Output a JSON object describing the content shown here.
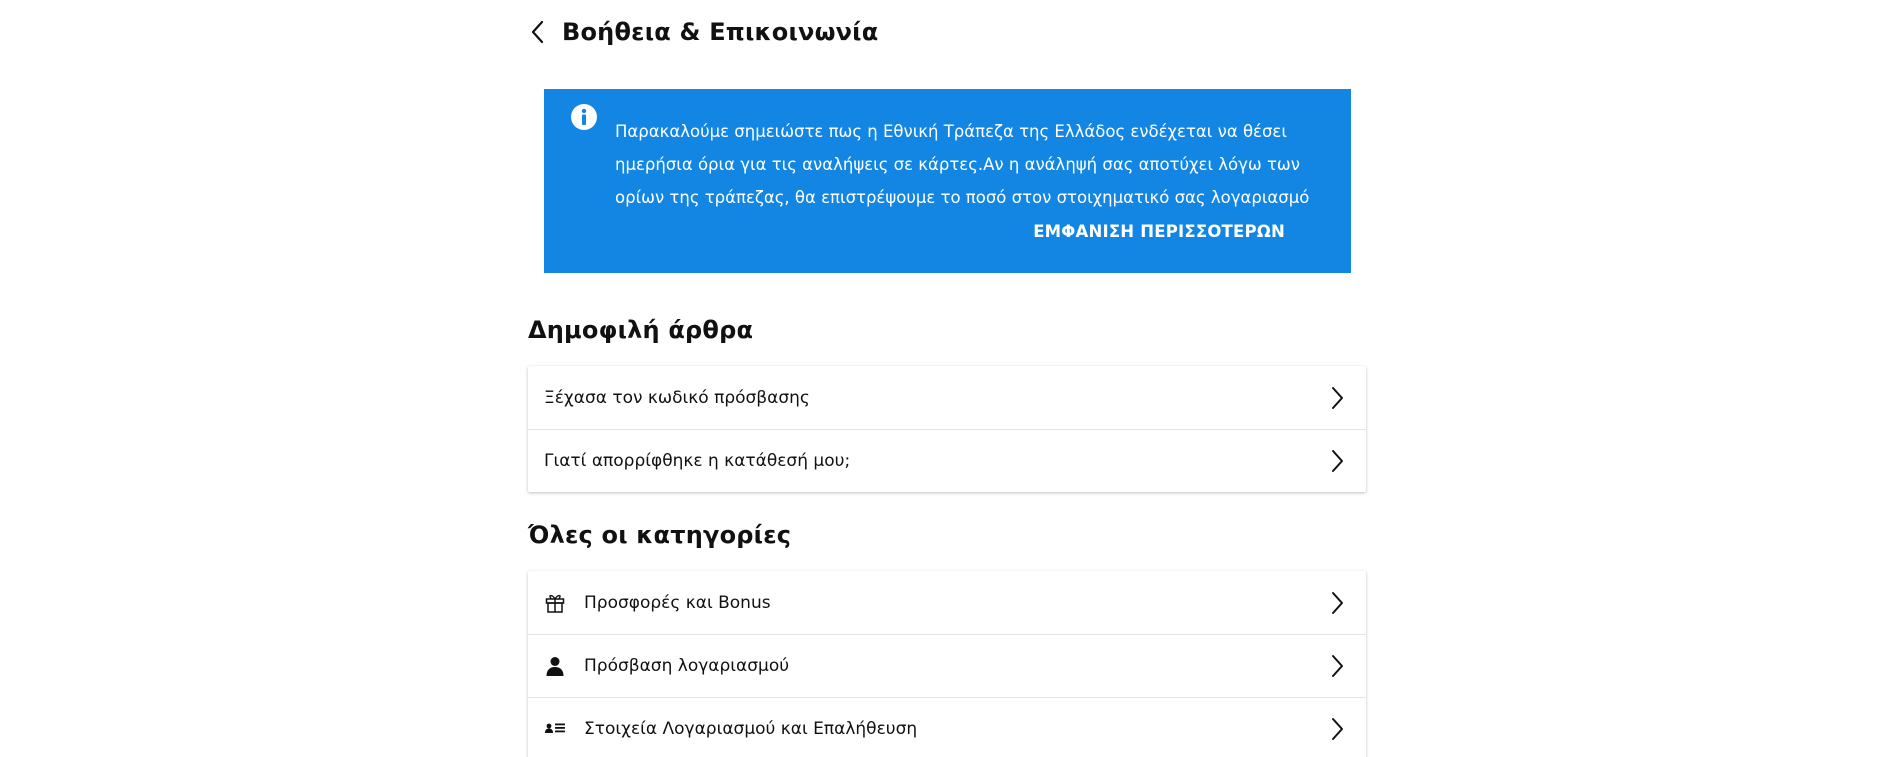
{
  "header": {
    "back_icon": "chevron-left-icon",
    "title": "Βοήθεια & Επικοινωνία"
  },
  "notice": {
    "icon": "info-icon",
    "text": "Παρακαλούμε σημειώστε πως η Εθνική Τράπεζα της Ελλάδος ενδέχεται να θέσει ημερήσια όρια για τις αναλήψεις σε κάρτες.Αν η ανάληψή σας αποτύχει λόγω των ορίων της τράπεζας, θα επιστρέψουμε το ποσό στον στοιχηματικό σας λογαριασμό και",
    "more_label": "ΕΜΦΑΝΙΣΗ ΠΕΡΙΣΣΟΤΕΡΩΝ",
    "background_color": "#1286e2"
  },
  "popular": {
    "title": "Δημοφιλή άρθρα",
    "items": [
      {
        "label": "Ξέχασα τον κωδικό πρόσβασης"
      },
      {
        "label": "Γιατί απορρίφθηκε η κατάθεσή μου;"
      }
    ]
  },
  "categories": {
    "title": "Όλες οι κατηγορίες",
    "items": [
      {
        "label": "Προσφορές και Bonus",
        "icon": "gift-icon"
      },
      {
        "label": "Πρόσβαση λογαριασμού",
        "icon": "user-icon"
      },
      {
        "label": "Στοιχεία Λογαριασμού και Επαλήθευση",
        "icon": "id-card-list-icon"
      }
    ]
  }
}
